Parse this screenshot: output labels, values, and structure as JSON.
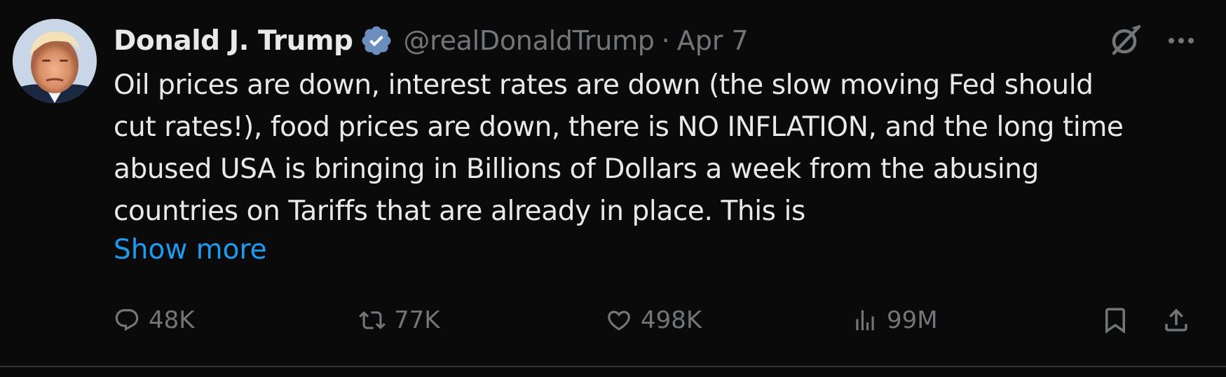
{
  "author": {
    "display_name": "Donald J. Trump",
    "handle": "@realDonaldTrump",
    "separator": "·",
    "date": "Apr 7",
    "verified": true,
    "avatar_icon": "avatar-photo"
  },
  "tweet": {
    "text_lines": [
      "Oil prices are down, interest rates are down (the slow moving Fed should",
      "cut rates!), food prices are down, there is NO INFLATION, and the long time",
      "abused USA is bringing in Billions of Dollars a week from the abusing",
      "countries on Tariffs that are already in place. This is"
    ],
    "show_more_label": "Show more"
  },
  "actions": {
    "replies": "48K",
    "reposts": "77K",
    "likes": "498K",
    "views": "99M"
  },
  "colors": {
    "background": "#0a0a0a",
    "text": "#e7e9ea",
    "muted": "#71767b",
    "link": "#1d9bf0",
    "verified_badge": "#1d9bf0"
  },
  "icons": {
    "verified": "verified-badge-icon",
    "grok": "grok-icon",
    "more": "more-dots-icon",
    "reply": "reply-icon",
    "repost": "repost-icon",
    "like": "heart-icon",
    "views": "views-chart-icon",
    "bookmark": "bookmark-icon",
    "share": "share-icon"
  }
}
